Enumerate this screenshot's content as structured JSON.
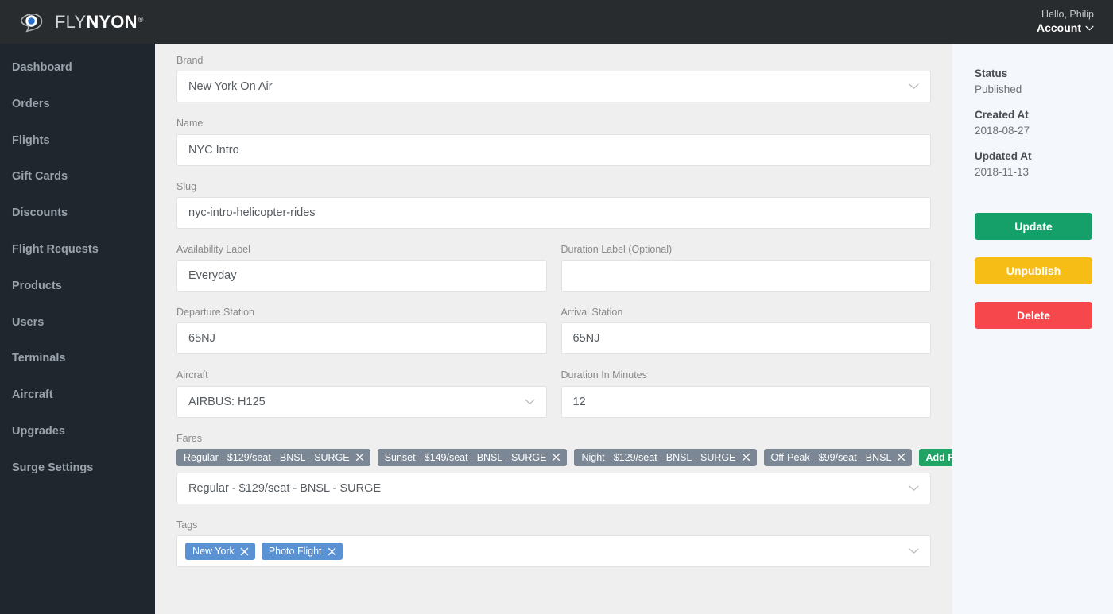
{
  "header": {
    "logo": {
      "icon": "flynyon-eye-logo-icon",
      "text_light": "FLY",
      "text_bold": "NYON",
      "registered": "®"
    },
    "greeting": "Hello, Philip",
    "account_label": "Account",
    "account_chevron": "chevron-down-icon"
  },
  "sidebar": {
    "items": [
      {
        "label": "Dashboard",
        "key": "dashboard"
      },
      {
        "label": "Orders",
        "key": "orders"
      },
      {
        "label": "Flights",
        "key": "flights"
      },
      {
        "label": "Gift Cards",
        "key": "gift-cards"
      },
      {
        "label": "Discounts",
        "key": "discounts"
      },
      {
        "label": "Flight Requests",
        "key": "flight-requests"
      },
      {
        "label": "Products",
        "key": "products"
      },
      {
        "label": "Users",
        "key": "users"
      },
      {
        "label": "Terminals",
        "key": "terminals"
      },
      {
        "label": "Aircraft",
        "key": "aircraft"
      },
      {
        "label": "Upgrades",
        "key": "upgrades"
      },
      {
        "label": "Surge Settings",
        "key": "surge-settings"
      }
    ]
  },
  "form": {
    "brand": {
      "label": "Brand",
      "value": "New York On Air",
      "type": "select"
    },
    "name": {
      "label": "Name",
      "value": "NYC Intro",
      "type": "text"
    },
    "slug": {
      "label": "Slug",
      "value": "nyc-intro-helicopter-rides",
      "type": "text"
    },
    "availability_label": {
      "label": "Availability Label",
      "value": "Everyday",
      "type": "text"
    },
    "duration_label": {
      "label": "Duration Label (Optional)",
      "value": "",
      "type": "text"
    },
    "departure_station": {
      "label": "Departure Station",
      "value": "65NJ",
      "type": "text"
    },
    "arrival_station": {
      "label": "Arrival Station",
      "value": "65NJ",
      "type": "text"
    },
    "aircraft": {
      "label": "Aircraft",
      "value": "AIRBUS: H125",
      "type": "select"
    },
    "duration_minutes": {
      "label": "Duration In Minutes",
      "value": "12",
      "type": "text"
    },
    "fares": {
      "label": "Fares",
      "chips": [
        "Regular - $129/seat - BNSL - SURGE",
        "Sunset - $149/seat - BNSL - SURGE",
        "Night - $129/seat - BNSL - SURGE",
        "Off-Peak - $99/seat - BNSL"
      ],
      "add_button": "Add Fare",
      "selected": "Regular - $129/seat - BNSL - SURGE",
      "chip_remove_icon": "close-x-icon"
    },
    "tags": {
      "label": "Tags",
      "chips": [
        "New York",
        "Photo Flight"
      ],
      "chip_remove_icon": "close-x-icon"
    }
  },
  "aside": {
    "status_label": "Status",
    "status_value": "Published",
    "created_label": "Created At",
    "created_value": "2018-08-27",
    "updated_label": "Updated At",
    "updated_value": "2018-11-13",
    "update_button": "Update",
    "unpublish_button": "Unpublish",
    "delete_button": "Delete"
  },
  "colors": {
    "topbar": "#282c2e",
    "sidebar": "#1f262e",
    "main_bg": "#efefef",
    "aside_bg": "#f4f7fb",
    "update_green": "#15a06a",
    "unpublish_yellow": "#f7bd17",
    "delete_red": "#f6474c",
    "fare_chip": "#7b8794",
    "tag_chip": "#5b92d4",
    "add_fare_green": "#21a366",
    "logo_blue": "#2a6fc9"
  }
}
